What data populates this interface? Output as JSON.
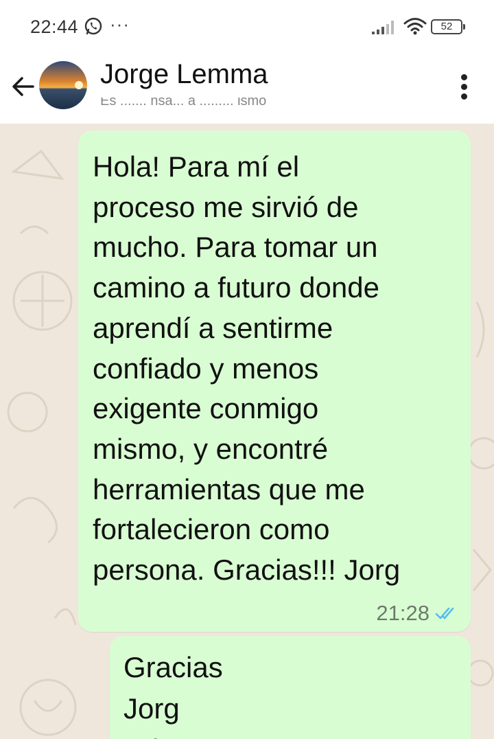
{
  "status_bar": {
    "time": "22:44",
    "notification_icon": "whatsapp-icon",
    "overflow_dots": "···",
    "signal_icon": "signal-icon",
    "wifi_icon": "wifi-icon",
    "battery_level": "52"
  },
  "header": {
    "back_icon": "arrow-left-icon",
    "contact_name": "Jorge Lemma",
    "contact_status": "Es ....... nsa... a ......... ismo",
    "menu_icon": "more-vertical-icon"
  },
  "messages": [
    {
      "text": "Hola! Para mí el\nproceso me sirvió de\nmucho. Para tomar un\ncamino a futuro donde\naprendí a sentirme\nconfiado y menos\nexigente conmigo\nmismo, y encontré\nherramientas que me\nfortalecieron como\npersona. Gracias!!! Jorg",
      "time": "21:28",
      "status": "read"
    },
    {
      "text": "Gracias\nJorg\nD       l"
    }
  ],
  "colors": {
    "chat_background": "#efe7dc",
    "outgoing_bubble": "#d9fdd3",
    "read_ticks": "#53bdeb"
  }
}
